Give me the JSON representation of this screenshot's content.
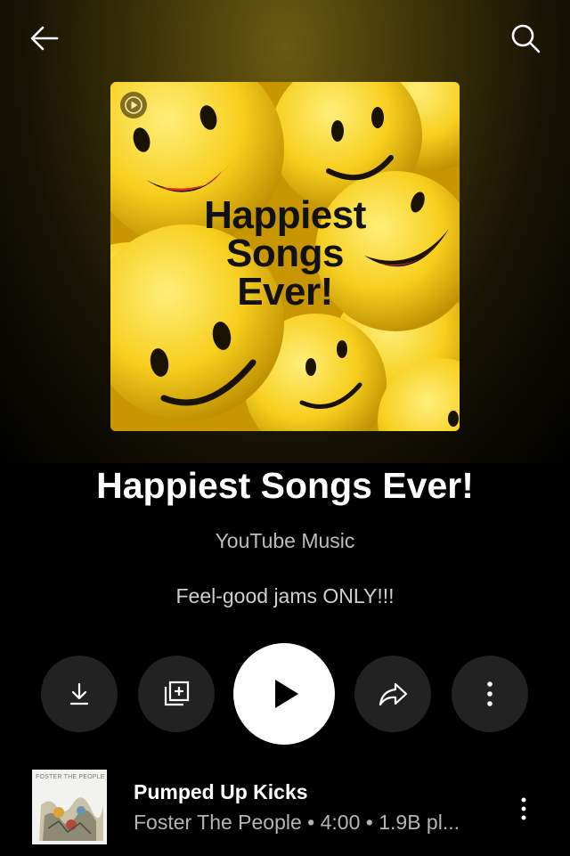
{
  "header": {
    "back_icon": "arrow-left-icon",
    "search_icon": "search-icon"
  },
  "cover": {
    "title_lines": [
      "Happiest",
      "Songs",
      "Ever!"
    ],
    "badge_icon": "play-badge-icon"
  },
  "playlist": {
    "title": "Happiest Songs Ever!",
    "owner": "YouTube Music",
    "description": "Feel-good jams ONLY!!!"
  },
  "actions": {
    "download_icon": "download-icon",
    "add_to_library_icon": "add-to-library-icon",
    "play_icon": "play-icon",
    "share_icon": "share-icon",
    "more_icon": "more-vert-icon"
  },
  "tracks": [
    {
      "title": "Pumped Up Kicks",
      "meta": "Foster The People • 4:00 • 1.9B pl...",
      "thumb_label": "FOSTER THE PEOPLE"
    }
  ],
  "colors": {
    "background": "#000000",
    "action_button": "#222222",
    "play_button": "#ffffff",
    "secondary_text": "#b5b5b5"
  }
}
